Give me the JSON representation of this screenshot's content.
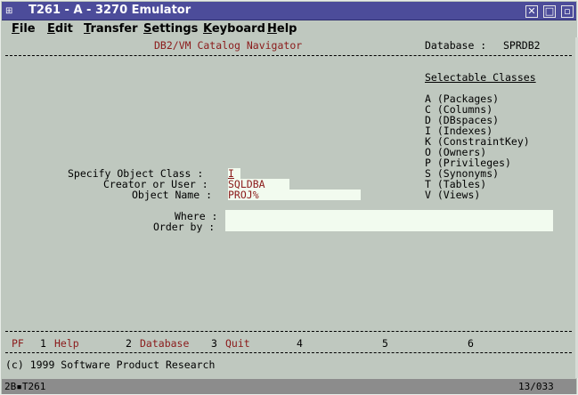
{
  "window": {
    "title": "T261 - A - 3270 Emulator",
    "close_glyph": "✕",
    "restore_glyph": "□",
    "minimize_glyph": "▫"
  },
  "menu": {
    "items": [
      {
        "label_u": "F",
        "label_rest": "ile"
      },
      {
        "label_u": "E",
        "label_rest": "dit"
      },
      {
        "label_u": "T",
        "label_rest": "ransfer"
      },
      {
        "label_u": "S",
        "label_rest": "ettings"
      },
      {
        "label_u": "K",
        "label_rest": "eyboard"
      },
      {
        "label_u": "H",
        "label_rest": "elp"
      }
    ]
  },
  "screen": {
    "title": "DB2/VM Catalog Navigator",
    "database_label": "Database :",
    "database_value": "SPRDB2",
    "classes_heading": "Selectable Classes",
    "classes": [
      "A (Packages)",
      "C (Columns)",
      "D (DBspaces)",
      "I (Indexes)",
      "K (ConstraintKey)",
      "O (Owners)",
      "P (Privileges)",
      "S (Synonyms)",
      "T (Tables)",
      "V (Views)"
    ],
    "fields": {
      "object_class_label": "Specify Object Class :",
      "object_class_value": "I",
      "creator_label": "Creator or User :",
      "creator_value": "SQLDBA",
      "object_name_label": "Object Name :",
      "object_name_value": "PROJ%",
      "where_label": "Where :",
      "order_by_label": "Order by :"
    },
    "pf": {
      "label": "PF",
      "keys": [
        {
          "num": "1",
          "label": "Help"
        },
        {
          "num": "2",
          "label": "Database"
        },
        {
          "num": "3",
          "label": "Quit"
        },
        {
          "num": "4",
          "label": ""
        },
        {
          "num": "5",
          "label": ""
        },
        {
          "num": "6",
          "label": ""
        }
      ]
    },
    "copyright": "(c) 1999 Software Product Research"
  },
  "status": {
    "session": "2B▪T261",
    "cursor_position": "13/033"
  }
}
